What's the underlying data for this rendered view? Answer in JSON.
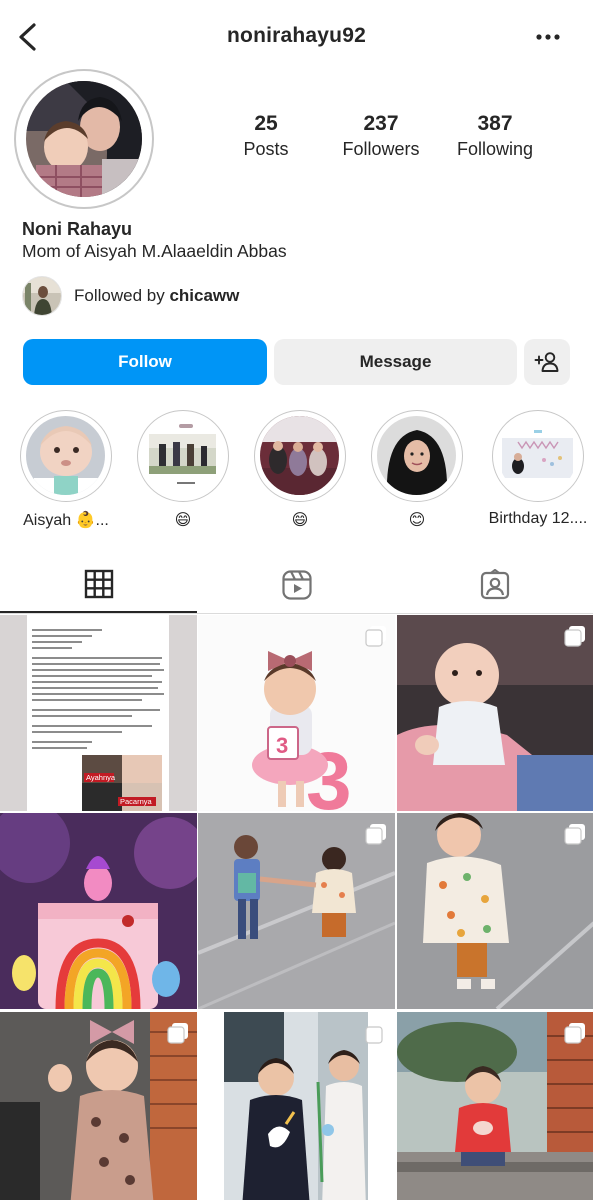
{
  "header": {
    "username": "nonirahayu92"
  },
  "profile": {
    "display_name": "Noni Rahayu",
    "bio": "Mom of Aisyah M.Alaaeldin Abbas",
    "stats": {
      "posts_count": "25",
      "posts_label": "Posts",
      "followers_count": "237",
      "followers_label": "Followers",
      "following_count": "387",
      "following_label": "Following"
    },
    "followed_by_prefix": "Followed by ",
    "followed_by_user": "chicaww"
  },
  "actions": {
    "follow_label": "Follow",
    "message_label": "Message"
  },
  "highlights": [
    {
      "label": "Aisyah 👶..."
    },
    {
      "label": "😄"
    },
    {
      "label": "😄"
    },
    {
      "label": "😊"
    },
    {
      "label": "Birthday 12...."
    }
  ],
  "post_text": {
    "ayahnya": "Ayahnya",
    "pacarnya": "Pacarnya",
    "cake_number": "3"
  },
  "colors": {
    "accent": "#0095f6",
    "button_gray": "#efefef",
    "text": "#262626",
    "divider": "#dbdbdb"
  },
  "icons": {
    "back": "chevron-left-icon",
    "more": "more-horizontal-icon",
    "add_user": "add-user-icon",
    "grid_tab": "grid-icon",
    "reels_tab": "reels-icon",
    "tagged_tab": "tagged-icon",
    "multi_post": "carousel-icon"
  }
}
